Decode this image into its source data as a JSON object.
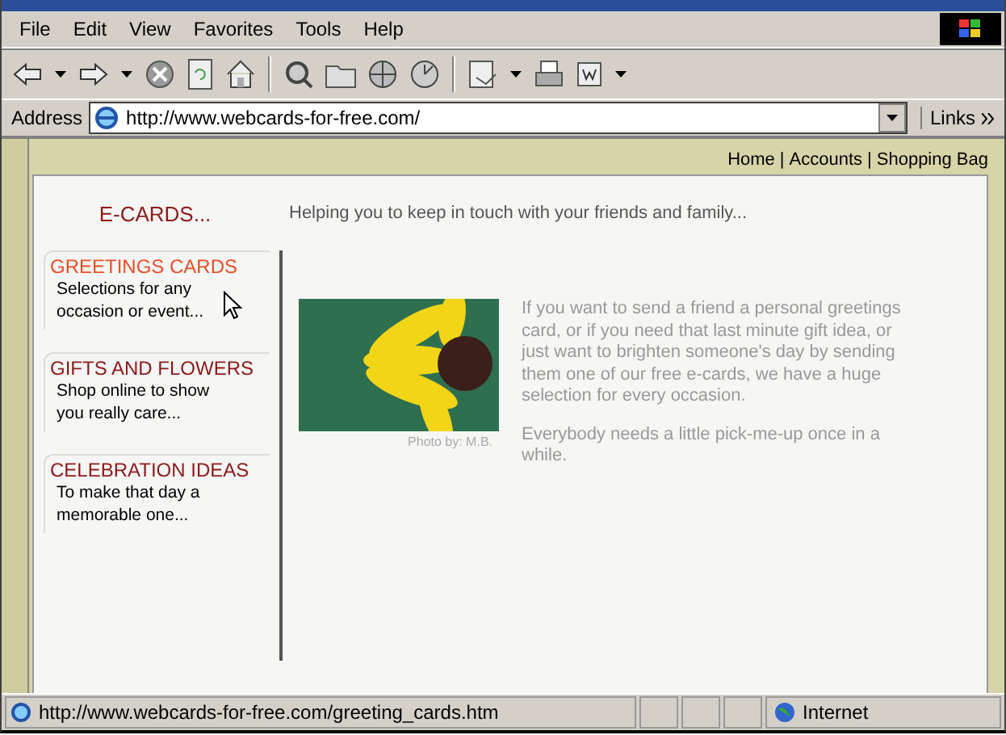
{
  "menu": [
    "File",
    "Edit",
    "View",
    "Favorites",
    "Tools",
    "Help"
  ],
  "address_bar": {
    "label": "Address",
    "value": "http://www.webcards-for-free.com/",
    "links": "Links"
  },
  "top_links": [
    "Home",
    "Accounts",
    "Shopping Bag"
  ],
  "top_links_separator": "|",
  "site": {
    "heading": "E-CARDS...",
    "tagline": "Helping you to keep in touch with your friends and family..."
  },
  "sidebar": {
    "items": [
      {
        "title": "GREETINGS CARDS",
        "text": "Selections for any occasion or event...",
        "selected": true
      },
      {
        "title": "GIFTS AND FLOWERS",
        "text": "Shop online to show you really care...",
        "selected": false
      },
      {
        "title": "CELEBRATION IDEAS",
        "text": "To make that day a memorable one...",
        "selected": false
      }
    ]
  },
  "photo": {
    "caption": "Photo by: M.B."
  },
  "paragraphs": [
    "If you want to send a friend a personal greetings card, or if you need that last minute gift idea, or just want to brighten someone's day by sending them one of our free e-cards, we have a huge selection for every occasion.",
    "Everybody needs a little pick-me-up once in a while."
  ],
  "status_bar": {
    "url": "http://www.webcards-for-free.com/greeting_cards.htm",
    "zone": "Internet"
  }
}
